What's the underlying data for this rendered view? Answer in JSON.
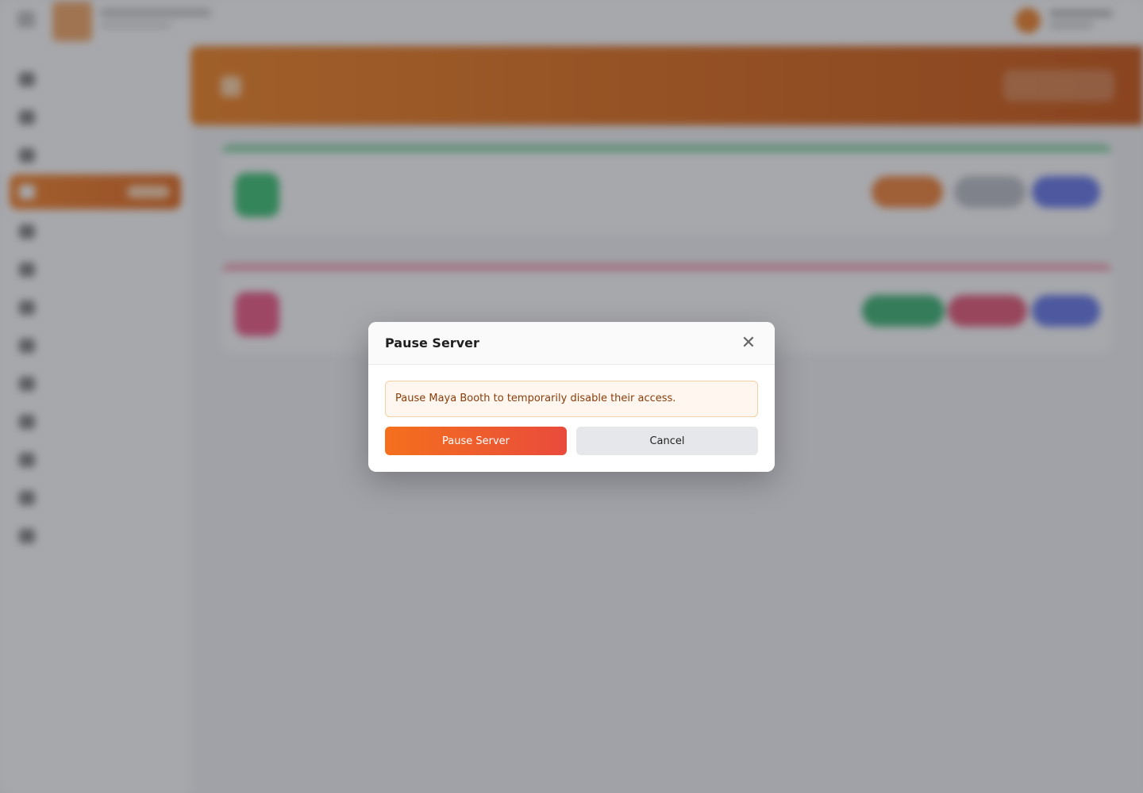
{
  "modal": {
    "title": "Pause Server",
    "close_glyph": "✕",
    "close_icon": "close-icon",
    "message": "Pause Maya Booth to temporarily disable their access.",
    "confirm_label": "Pause Server",
    "cancel_label": "Cancel"
  },
  "colors": {
    "accent_orange": "#f4701d",
    "accent_red": "#e94b3c",
    "alert_bg": "#fff7ef",
    "alert_text": "#8a3b0a"
  }
}
